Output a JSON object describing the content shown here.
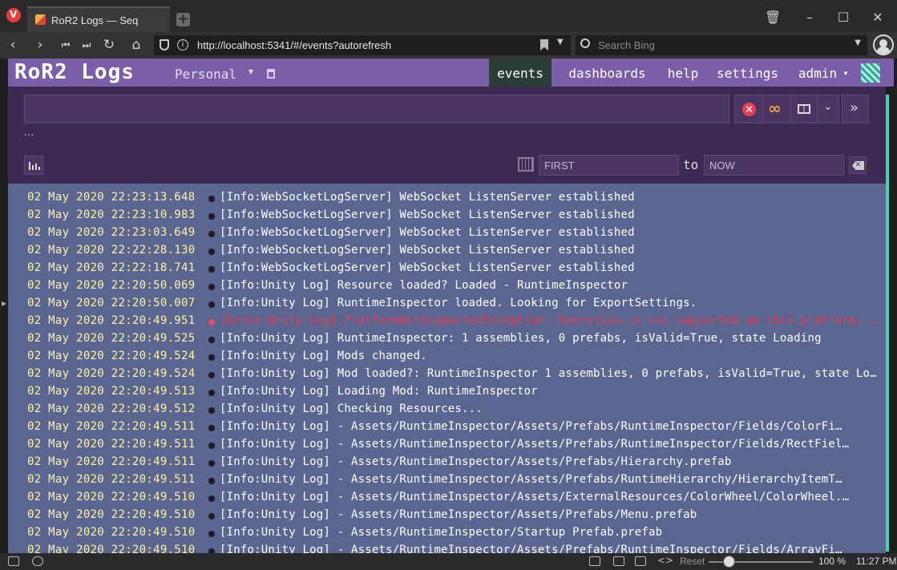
{
  "browser": {
    "tab_title": "RoR2 Logs — Seq",
    "url": "http://localhost:5341/#/events?autorefresh",
    "search_placeholder": "Search Bing",
    "zoom": "100 %",
    "reset_label": "Reset",
    "clock": "11:27 PM"
  },
  "app": {
    "title": "RoR2 Logs",
    "workspace": "Personal",
    "nav": {
      "events": "events",
      "dashboards": "dashboards",
      "help": "help",
      "settings": "settings",
      "admin": "admin"
    },
    "accent_color": "#7a5ea8",
    "active_nav_color": "#2a3e38"
  },
  "filter": {
    "query": "",
    "ellipsis": "...",
    "range_from_placeholder": "FIRST",
    "range_to_placeholder": "NOW",
    "to_label": "to"
  },
  "events": [
    {
      "time": "02 May 2020 22:23:13.648",
      "message": "[Info:WebSocketLogServer] WebSocket ListenServer established",
      "level": "info"
    },
    {
      "time": "02 May 2020 22:23:10.983",
      "message": "[Info:WebSocketLogServer] WebSocket ListenServer established",
      "level": "info"
    },
    {
      "time": "02 May 2020 22:23:03.649",
      "message": "[Info:WebSocketLogServer] WebSocket ListenServer established",
      "level": "info"
    },
    {
      "time": "02 May 2020 22:22:28.130",
      "message": "[Info:WebSocketLogServer] WebSocket ListenServer established",
      "level": "info"
    },
    {
      "time": "02 May 2020 22:22:18.741",
      "message": "[Info:WebSocketLogServer] WebSocket ListenServer established",
      "level": "info"
    },
    {
      "time": "02 May 2020 22:20:50.069",
      "message": "[Info:Unity Log] Resource loaded? Loaded - RuntimeInspector",
      "level": "info"
    },
    {
      "time": "02 May 2020 22:20:50.007",
      "message": "[Info:Unity Log] RuntimeInspector loaded. Looking for ExportSettings.",
      "level": "info"
    },
    {
      "time": "02 May 2020 22:20:49.951",
      "message": "[Error:Unity Log] PlatformNotSupportedException: Operation is not supported on this platform. St…",
      "level": "error"
    },
    {
      "time": "02 May 2020 22:20:49.525",
      "message": "[Info:Unity Log] RuntimeInspector: 1 assemblies, 0 prefabs, isValid=True, state Loading",
      "level": "info"
    },
    {
      "time": "02 May 2020 22:20:49.524",
      "message": "[Info:Unity Log] Mods changed.",
      "level": "info"
    },
    {
      "time": "02 May 2020 22:20:49.524",
      "message": "[Info:Unity Log] Mod loaded?: RuntimeInspector 1 assemblies, 0 prefabs, isValid=True, state Loading",
      "level": "info"
    },
    {
      "time": "02 May 2020 22:20:49.513",
      "message": "[Info:Unity Log] Loading Mod: RuntimeInspector",
      "level": "info"
    },
    {
      "time": "02 May 2020 22:20:49.512",
      "message": "[Info:Unity Log] Checking Resources...",
      "level": "info"
    },
    {
      "time": "02 May 2020 22:20:49.511",
      "message": "[Info:Unity Log] - Assets/RuntimeInspector/Assets/Prefabs/RuntimeInspector/Fields/ColorFi…",
      "level": "info"
    },
    {
      "time": "02 May 2020 22:20:49.511",
      "message": "[Info:Unity Log] - Assets/RuntimeInspector/Assets/Prefabs/RuntimeInspector/Fields/RectFiel…",
      "level": "info"
    },
    {
      "time": "02 May 2020 22:20:49.511",
      "message": "[Info:Unity Log] - Assets/RuntimeInspector/Assets/Prefabs/Hierarchy.prefab",
      "level": "info"
    },
    {
      "time": "02 May 2020 22:20:49.511",
      "message": "[Info:Unity Log] - Assets/RuntimeInspector/Assets/Prefabs/RuntimeHierarchy/HierarchyItemT…",
      "level": "info"
    },
    {
      "time": "02 May 2020 22:20:49.510",
      "message": "[Info:Unity Log] - Assets/RuntimeInspector/Assets/ExternalResources/ColorWheel/ColorWheel.…",
      "level": "info"
    },
    {
      "time": "02 May 2020 22:20:49.510",
      "message": "[Info:Unity Log] - Assets/RuntimeInspector/Assets/Prefabs/Menu.prefab",
      "level": "info"
    },
    {
      "time": "02 May 2020 22:20:49.510",
      "message": "[Info:Unity Log] - Assets/RuntimeInspector/Startup Prefab.prefab",
      "level": "info"
    },
    {
      "time": "02 May 2020 22:20:49.510",
      "message": "[Info:Unity Log] - Assets/RuntimeInspector/Assets/Prefabs/RuntimeInspector/Fields/ArrayFi…",
      "level": "info"
    }
  ]
}
